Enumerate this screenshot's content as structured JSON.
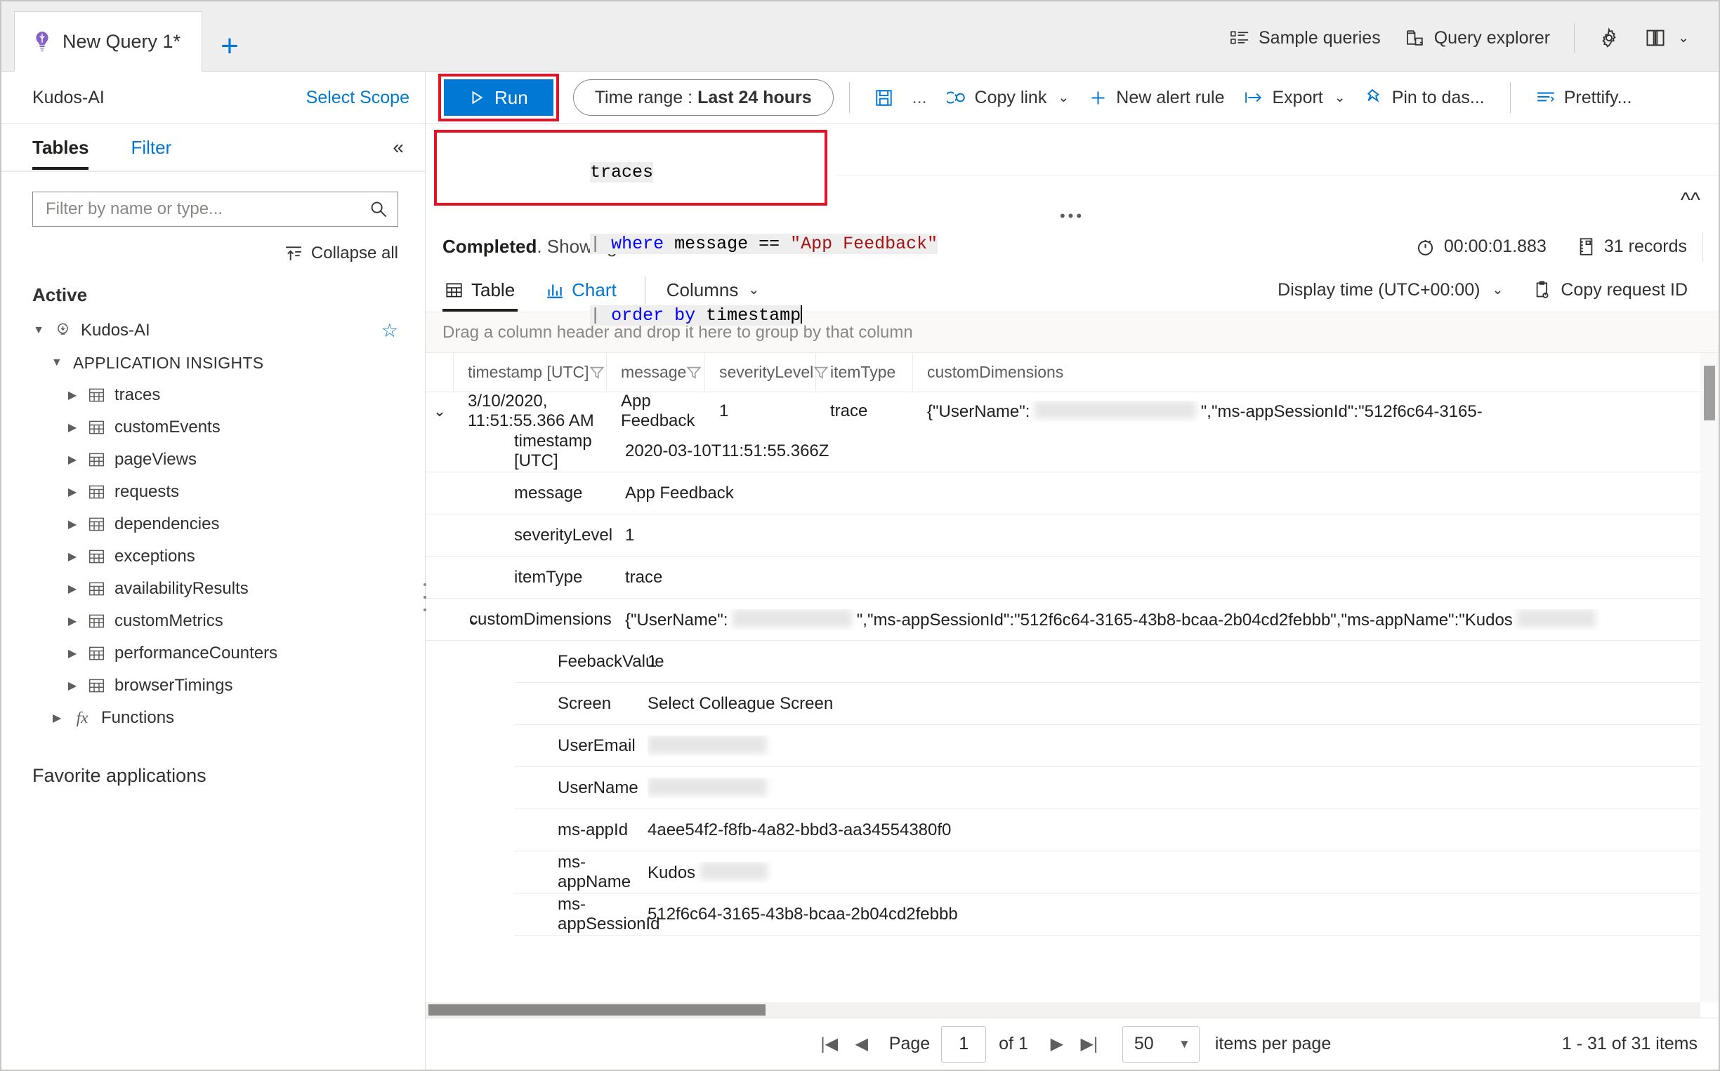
{
  "colors": {
    "accent": "#0078d4",
    "annotation": "#e81123",
    "neutral_text": "#323130",
    "placeholder": "#8a8886",
    "string_literal": "#a31515",
    "keyword": "#0000ff"
  },
  "tabstrip": {
    "tab_title": "New Query 1*",
    "tab_icon": "lightbulb-icon",
    "add_tab_label": "+",
    "right_buttons": [
      {
        "label": "Sample queries",
        "icon": "list-icon"
      },
      {
        "label": "Query explorer",
        "icon": "folder-query-icon"
      }
    ],
    "settings_icon": "gear-icon",
    "help_icon": "book-icon",
    "help_chevron": "⌄"
  },
  "scope": {
    "name": "Kudos-AI",
    "select_scope_label": "Select Scope"
  },
  "query_toolbar": {
    "run_label": "Run",
    "run_icon": "play-icon",
    "run_annotated": true,
    "time_range_prefix": "Time range :",
    "time_range_value": "Last 24 hours",
    "save_icon": "save-icon",
    "save_overflow": "...",
    "copy_link": {
      "label": "Copy link",
      "icon": "link-icon",
      "chevron": "⌄"
    },
    "new_alert_rule": {
      "label": "New alert rule",
      "icon": "plus-icon"
    },
    "export": {
      "label": "Export",
      "icon": "export-icon",
      "chevron": "⌄"
    },
    "pin_to_dashboard": {
      "label": "Pin to das...",
      "icon": "pin-icon"
    },
    "prettify": {
      "label": "Prettify...",
      "icon": "prettify-icon"
    }
  },
  "left_pane": {
    "tabs": [
      {
        "label": "Tables",
        "active": true
      },
      {
        "label": "Filter",
        "active": false
      }
    ],
    "collapse_pane_icon": "chevron-double-left-icon",
    "search": {
      "placeholder": "Filter by name or type...",
      "value": "",
      "icon": "search-icon"
    },
    "collapse_all_label": "Collapse all",
    "collapse_all_icon": "collapse-all-icon",
    "active_section_label": "Active",
    "workspace": {
      "label": "Kudos-AI",
      "icon": "lightbulb-icon",
      "expanded": true,
      "favorite_icon": "star-icon"
    },
    "group_label": "APPLICATION INSIGHTS",
    "tables": [
      {
        "label": "traces"
      },
      {
        "label": "customEvents"
      },
      {
        "label": "pageViews"
      },
      {
        "label": "requests"
      },
      {
        "label": "dependencies"
      },
      {
        "label": "exceptions"
      },
      {
        "label": "availabilityResults"
      },
      {
        "label": "customMetrics"
      },
      {
        "label": "performanceCounters"
      },
      {
        "label": "browserTimings"
      }
    ],
    "functions": {
      "label": "Functions",
      "icon": "fx-icon"
    },
    "favorite_applications_label": "Favorite applications"
  },
  "editor": {
    "annotated": true,
    "lines": [
      {
        "segments": [
          {
            "text": "traces",
            "kind": "plain"
          }
        ]
      },
      {
        "segments": [
          {
            "text": "| ",
            "kind": "pipe"
          },
          {
            "text": "where ",
            "kind": "keyword"
          },
          {
            "text": "message == ",
            "kind": "plain"
          },
          {
            "text": "\"App Feedback\"",
            "kind": "string"
          }
        ]
      },
      {
        "segments": [
          {
            "text": "| ",
            "kind": "pipe"
          },
          {
            "text": "order by ",
            "kind": "keyword"
          },
          {
            "text": "timestamp",
            "kind": "plain"
          }
        ]
      }
    ],
    "collapse_icon": "chevron-double-up-icon",
    "drag_handle": "•••"
  },
  "results": {
    "status_bold": "Completed",
    "status_rest": ". Showing results from the last 24 hours.",
    "duration": "00:00:01.883",
    "duration_icon": "timer-icon",
    "record_count": "31 records",
    "record_icon": "records-icon",
    "view_tabs": [
      {
        "label": "Table",
        "icon": "table-icon",
        "active": true
      },
      {
        "label": "Chart",
        "icon": "chart-icon",
        "active": false
      }
    ],
    "columns_button": {
      "label": "Columns",
      "chevron": "⌄"
    },
    "display_time": {
      "label": "Display time (UTC+00:00)",
      "chevron": "⌄"
    },
    "copy_request_id": {
      "label": "Copy request ID",
      "icon": "clipboard-icon"
    },
    "group_by_hint": "Drag a column header and drop it here to group by that column"
  },
  "grid": {
    "columns": [
      {
        "key": "timestamp",
        "label": "timestamp [UTC]",
        "filter_icon": "filter-icon"
      },
      {
        "key": "message",
        "label": "message",
        "filter_icon": "filter-icon"
      },
      {
        "key": "severityLevel",
        "label": "severityLevel",
        "filter_icon": "filter-icon"
      },
      {
        "key": "itemType",
        "label": "itemType",
        "filter_icon": "filter-icon"
      },
      {
        "key": "customDimensions",
        "label": "customDimensions",
        "filter_icon": ""
      }
    ],
    "row": {
      "expanded": true,
      "timestamp": "3/10/2020, 11:51:55.366 AM",
      "message": "App Feedback",
      "severityLevel": "1",
      "itemType": "trace",
      "customDimensions_preview_start": "{\"UserName\":",
      "customDimensions_preview_end": "\",\"ms-appSessionId\":\"512f6c64-3165-"
    },
    "detail_rows": [
      {
        "key": "timestamp [UTC]",
        "value": "2020-03-10T11:51:55.366Z",
        "type": "text"
      },
      {
        "key": "message",
        "value": "App Feedback",
        "type": "text"
      },
      {
        "key": "severityLevel",
        "value": "1",
        "type": "text"
      },
      {
        "key": "itemType",
        "value": "trace",
        "type": "text"
      }
    ],
    "custom_dimensions_row": {
      "key": "customDimensions",
      "expanded": true,
      "value_start": "{\"UserName\":",
      "value_mid": "\",\"ms-appSessionId\":\"512f6c64-3165-43b8-bcaa-2b04cd2febbb\",\"ms-appName\":\"Kudos",
      "value_end": ""
    },
    "nested_rows": [
      {
        "key": "FeebackValue",
        "value": "1",
        "redacted": false
      },
      {
        "key": "Screen",
        "value": "Select Colleague Screen",
        "redacted": false
      },
      {
        "key": "UserEmail",
        "value": "",
        "redacted": true
      },
      {
        "key": "UserName",
        "value": "",
        "redacted": true
      },
      {
        "key": "ms-appId",
        "value": "4aee54f2-f8fb-4a82-bbd3-aa34554380f0",
        "redacted": false
      },
      {
        "key": "ms-appName",
        "value": "Kudos",
        "redacted": true
      },
      {
        "key": "ms-appSessionId",
        "value": "512f6c64-3165-43b8-bcaa-2b04cd2febbb",
        "redacted": false
      }
    ]
  },
  "pager": {
    "first_icon": "|◀",
    "prev_icon": "◀",
    "page_label": "Page",
    "page_value": "1",
    "of_label": "of 1",
    "next_icon": "▶",
    "last_icon": "▶|",
    "page_size": "50",
    "page_size_chevron": "▼",
    "items_per_page_label": "items per page",
    "range_label": "1 - 31 of 31 items"
  }
}
